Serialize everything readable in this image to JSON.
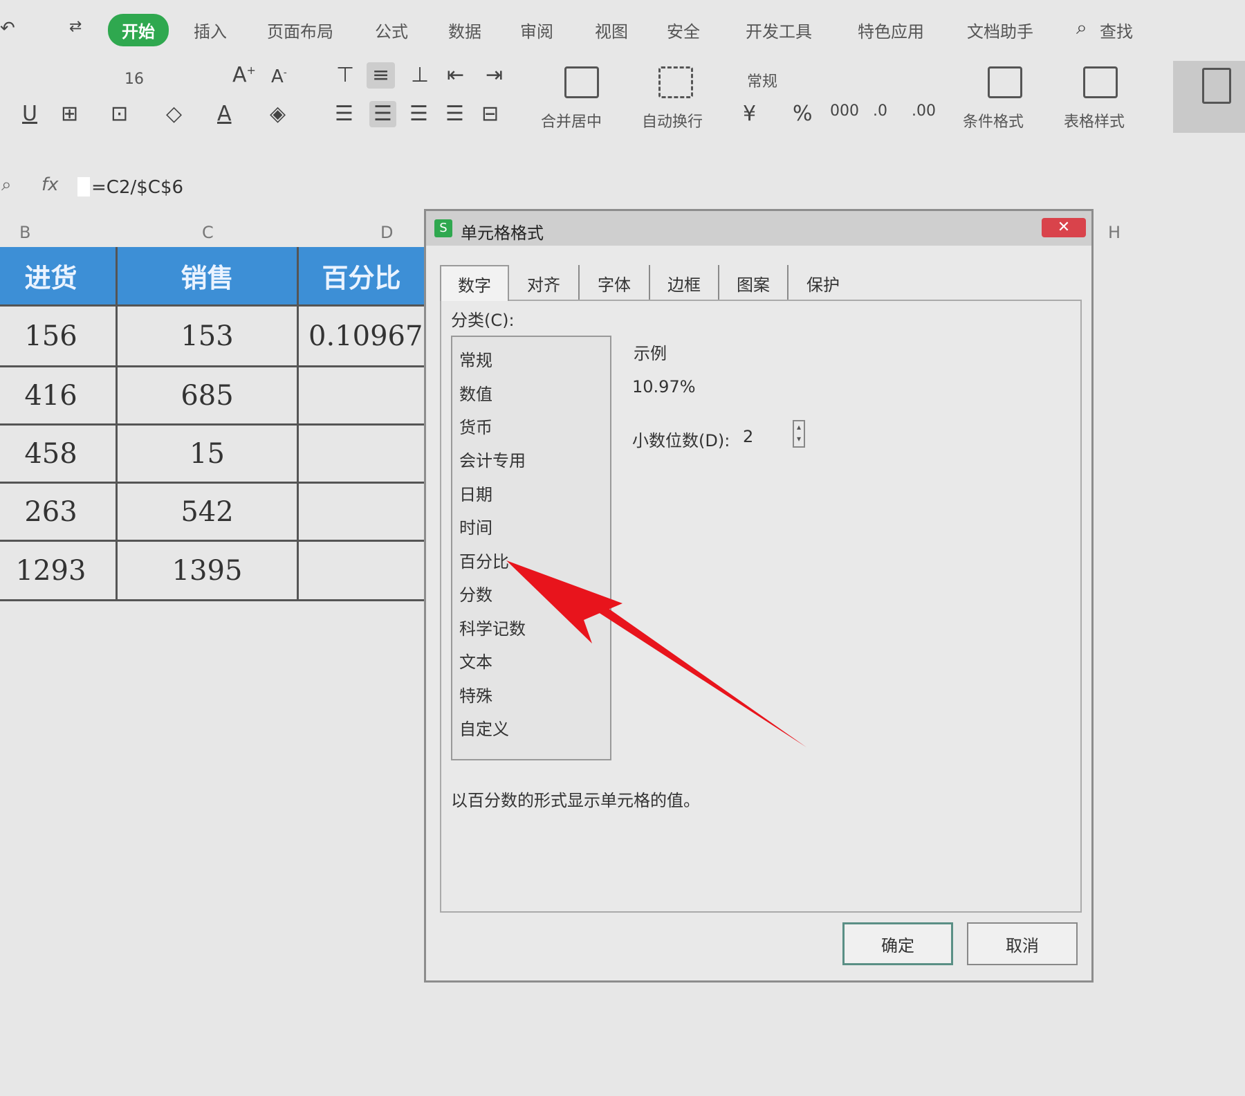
{
  "ribbon": {
    "tabs": [
      "开始",
      "插入",
      "页面布局",
      "公式",
      "数据",
      "审阅",
      "视图",
      "安全",
      "开发工具",
      "特色应用",
      "文档助手",
      "查找"
    ],
    "font_size": "16",
    "merge_label": "合并居中",
    "wrap_label": "自动换行",
    "number_format": "常规",
    "cond_format_label": "条件格式",
    "table_style_label": "表格样式"
  },
  "formula_bar": {
    "fx_symbol": "fx",
    "formula": "=C2/$C$6"
  },
  "sheet": {
    "columns": [
      "B",
      "C",
      "D",
      "H"
    ],
    "header_b": "进货",
    "header_c": "销售",
    "header_d": "百分比",
    "rows": [
      {
        "b": "156",
        "c": "153",
        "d": "0.10967"
      },
      {
        "b": "416",
        "c": "685",
        "d": ""
      },
      {
        "b": "458",
        "c": "15",
        "d": ""
      },
      {
        "b": "263",
        "c": "542",
        "d": ""
      },
      {
        "b": "1293",
        "c": "1395",
        "d": ""
      }
    ]
  },
  "dialog": {
    "title": "单元格格式",
    "tabs": [
      "数字",
      "对齐",
      "字体",
      "边框",
      "图案",
      "保护"
    ],
    "category_label": "分类(C):",
    "categories": [
      "常规",
      "数值",
      "货币",
      "会计专用",
      "日期",
      "时间",
      "百分比",
      "分数",
      "科学记数",
      "文本",
      "特殊",
      "自定义"
    ],
    "selected_category": "百分比",
    "sample_label": "示例",
    "sample_value": "10.97%",
    "decimal_label": "小数位数(D):",
    "decimal_value": "2",
    "description": "以百分数的形式显示单元格的值。",
    "ok_label": "确定",
    "cancel_label": "取消"
  },
  "colors": {
    "active_tab": "#2fa84f",
    "header_fill": "#3d8fd6",
    "arrow": "#e8141c"
  }
}
